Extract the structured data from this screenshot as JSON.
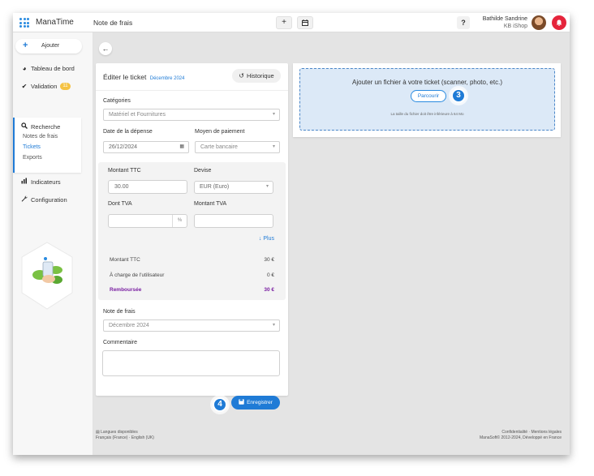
{
  "app": {
    "name": "ManaTime"
  },
  "header": {
    "title": "Note de frais",
    "add_icon": "plus-icon",
    "calendar_icon": "calendar-icon",
    "help_label": "?",
    "user_name": "Bathilde Sandrine",
    "user_org": "KB iShop"
  },
  "sidebar": {
    "add_label": "Ajouter",
    "items": [
      {
        "label": "Tableau de bord",
        "icon": "pie-chart-icon"
      },
      {
        "label": "Validation",
        "icon": "check-icon",
        "badge": "11"
      },
      {
        "label": "Recherche",
        "icon": "search-icon"
      },
      {
        "label": "Indicateurs",
        "icon": "bar-chart-icon"
      },
      {
        "label": "Configuration",
        "icon": "wrench-icon"
      }
    ],
    "sub_items": [
      {
        "label": "Notes de frais"
      },
      {
        "label": "Tickets",
        "active": true
      },
      {
        "label": "Exports"
      }
    ]
  },
  "form": {
    "title": "Éditer le ticket",
    "month": "Décembre 2024",
    "history_label": "Historique",
    "category_label": "Catégories",
    "category_value": "Matériel et Fournitures",
    "date_label": "Date de la dépense",
    "date_value": "26/12/2024",
    "payment_label": "Moyen de paiement",
    "payment_value": "Carte bancaire",
    "amount_label": "Montant TTC",
    "amount_value": "30.00",
    "currency_label": "Devise",
    "currency_value": "EUR (Euro)",
    "vat_label": "Dont TVA",
    "vat_unit": "%",
    "vat_amount_label": "Montant TVA",
    "more_label": "Plus",
    "summary": [
      {
        "label": "Montant TTC",
        "value": "30 €"
      },
      {
        "label": "À charge de l'utilisateur",
        "value": "0 €"
      },
      {
        "label": "Remboursée",
        "value": "30 €"
      }
    ],
    "note_label": "Note de frais",
    "note_value": "Décembre 2024",
    "comment_label": "Commentaire",
    "save_label": "Enregistrer",
    "step_save": "4"
  },
  "upload": {
    "title": "Ajouter un fichier à votre ticket (scanner, photo, etc.)",
    "browse_label": "Parcourir",
    "note": "La taille du fichier doit être inférieure à 64 Mo",
    "step_browse": "3"
  },
  "footer": {
    "languages_title": "Langues disponibles",
    "languages": "Français (France) · English (UK)",
    "links": "Confidentialité · Mentions légales",
    "copyright": "ManaSoft© 2012-2024, Développé en France"
  },
  "colors": {
    "accent": "#1f7bd6",
    "danger": "#e5243b",
    "badge": "#f5c242",
    "reimbursed": "#7a1fa2"
  }
}
